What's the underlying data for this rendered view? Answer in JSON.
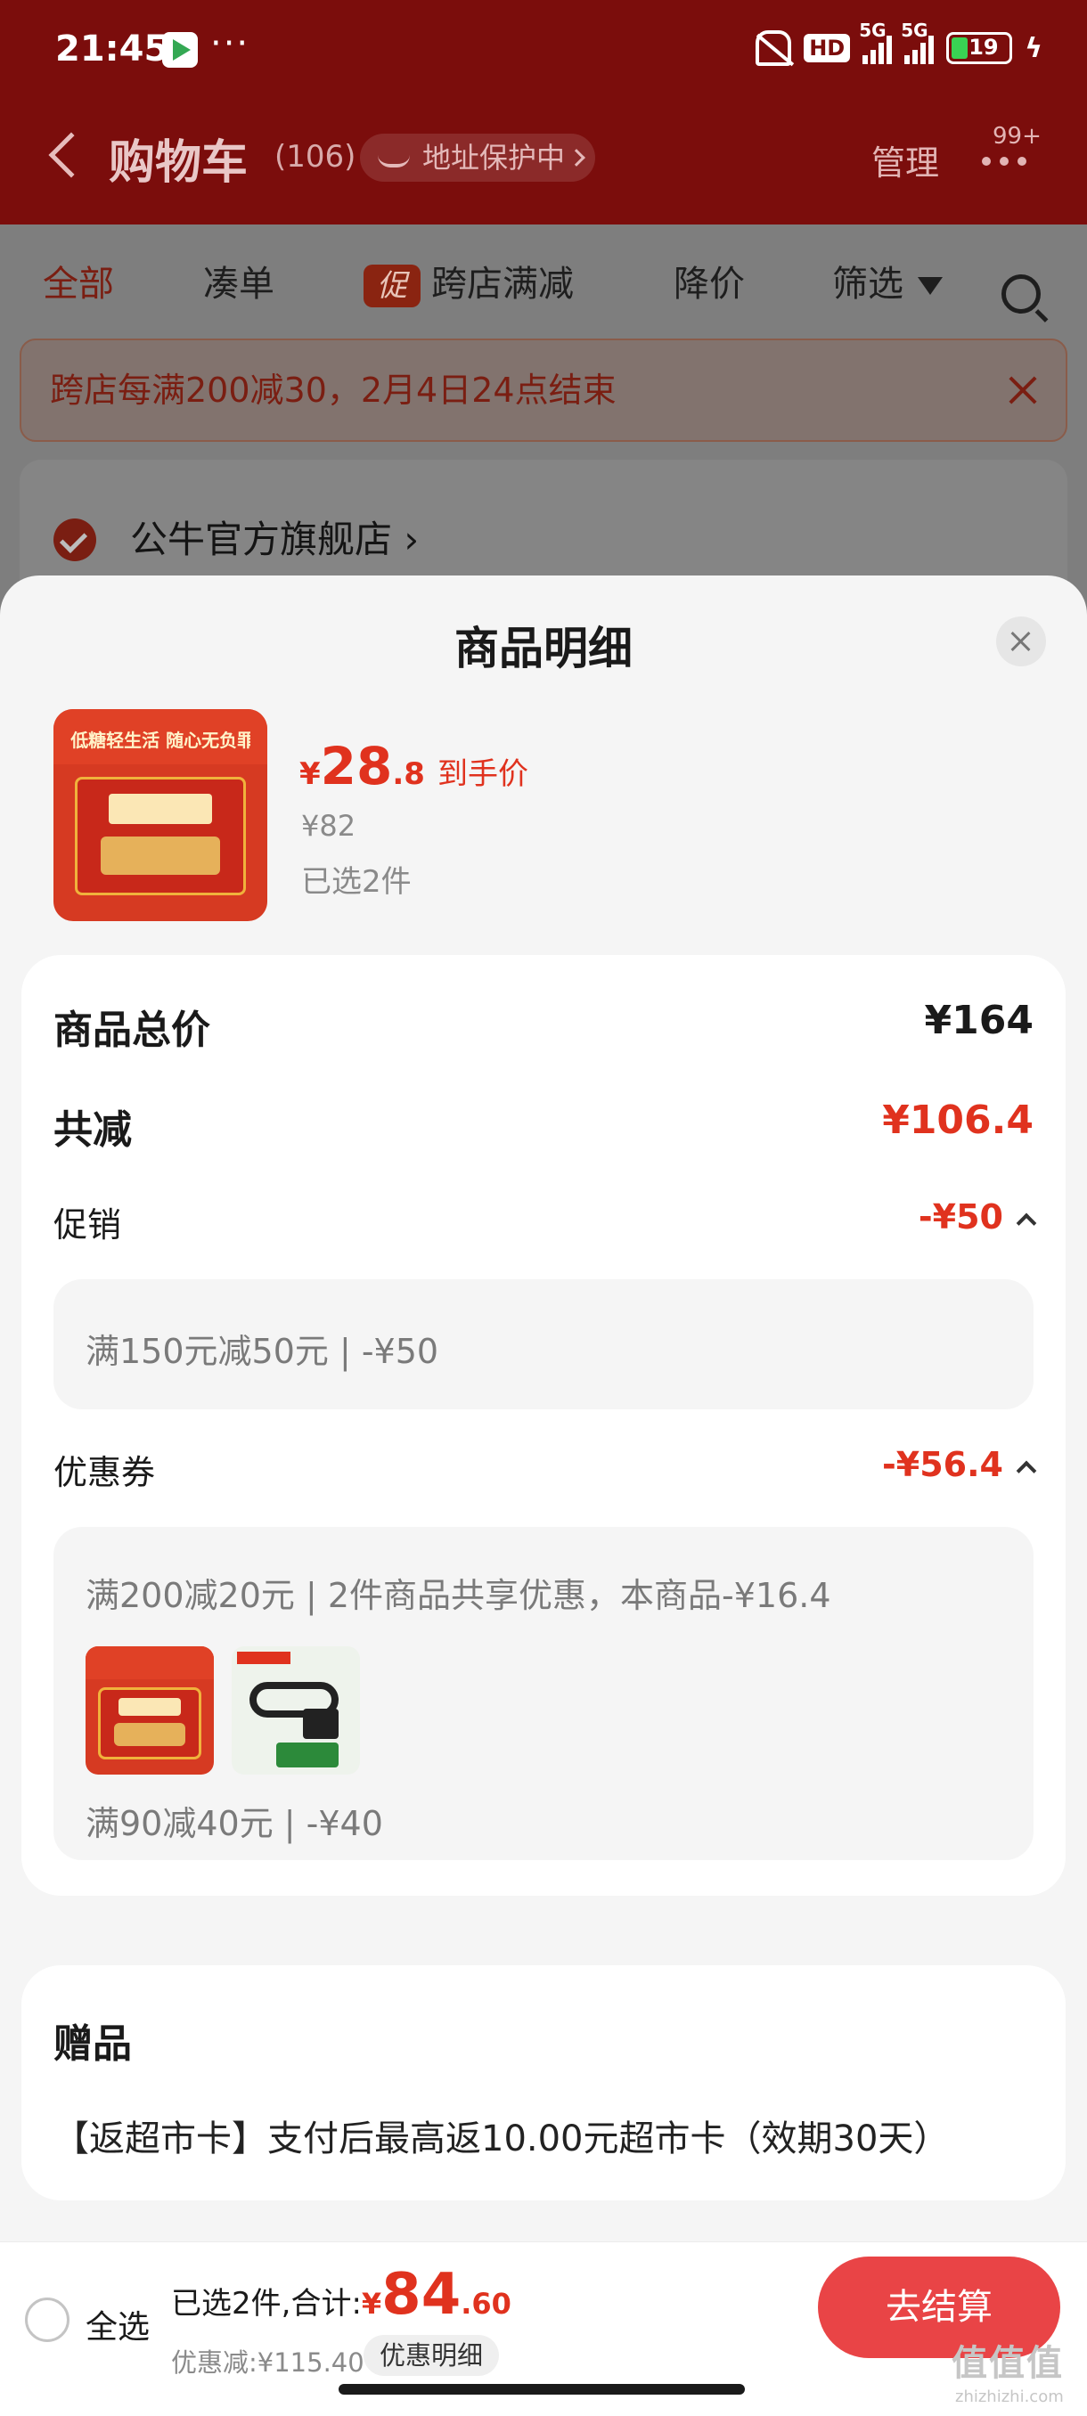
{
  "status_bar": {
    "time": "21:45",
    "dots": "···",
    "hd": "HD",
    "net1": "5G",
    "net2": "5G",
    "battery": "19",
    "bolt": "ϟ"
  },
  "nav": {
    "title": "购物车",
    "count": "(106)",
    "address_badge": "地址保护中",
    "manage": "管理",
    "more_badge": "99+"
  },
  "tabs": [
    {
      "label": "全部"
    },
    {
      "label": "凑单"
    },
    {
      "label": "跨店满减",
      "tag": "促"
    },
    {
      "label": "降价"
    },
    {
      "label": "筛选"
    }
  ],
  "notice": {
    "text": "跨店每满200减30，2月4日24点结束"
  },
  "store": {
    "name": "公牛官方旗舰店 ›"
  },
  "sheet": {
    "title": "商品明细",
    "product": {
      "price_yen": "¥",
      "price_main": "28",
      "price_dec": ".8",
      "price_tag": "到手价",
      "original_price": "¥82",
      "selected": "已选2件",
      "image_text": "低糖轻生活 随心无负罪"
    },
    "breakdown": {
      "total_label": "商品总价",
      "total_value": "¥164",
      "reduce_label": "共减",
      "reduce_value": "¥106.4",
      "promo_label": "促销",
      "promo_value": "-¥50",
      "promo_detail": "满150元减50元 | -¥50",
      "coupon_label": "优惠券",
      "coupon_value": "-¥56.4",
      "coupon_detail_1": "满200减20元 | 2件商品共享优惠，本商品-¥16.4",
      "coupon_detail_2": "满90减40元 | -¥40"
    },
    "gift": {
      "title": "赠品",
      "desc": "【返超市卡】支付后最高返10.00元超市卡（效期30天）"
    }
  },
  "checkout": {
    "select_all": "全选",
    "total_prefix": "已选2件,合计:",
    "total_yen": "¥",
    "total_main": "84",
    "total_dec": ".60",
    "discount": "优惠减:¥115.40",
    "detail_button": "优惠明细",
    "checkout_button": "去结算"
  },
  "watermark": {
    "text": "值值值",
    "sub": "zhizhizhi.com"
  }
}
